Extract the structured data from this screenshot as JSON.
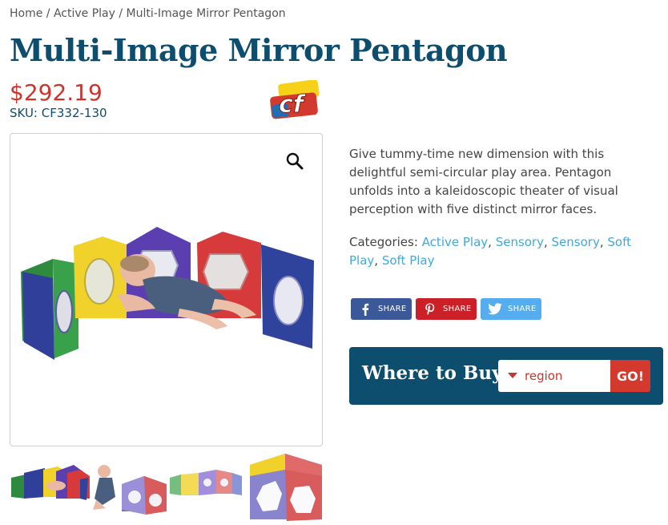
{
  "breadcrumb": {
    "home": "Home",
    "sep1": " / ",
    "category": "Active Play",
    "sep2": " / ",
    "current": "Multi-Image Mirror Pentagon"
  },
  "product": {
    "title": "Multi-Image Mirror Pentagon",
    "price": "$292.19",
    "sku_label": "SKU: ",
    "sku_value": "CF332-130",
    "brand_logo_text": "cf",
    "description": "Give tummy-time new dimension with this delightful semi-circular play area. Pentagon unfolds into a kaleidoscopic theater of visual perception with five distinct mirror faces.",
    "categories_label": "Categories: ",
    "categories": [
      "Active Play",
      "Sensory",
      "Sensory",
      "Soft Play",
      "Soft Play"
    ],
    "category_separator": ", "
  },
  "gallery": {
    "zoom_icon": "magnifier-icon",
    "thumbnail_count": 4
  },
  "share": {
    "facebook_label": "SHARE",
    "pinterest_label": "SHARE",
    "twitter_label": "SHARE"
  },
  "where_to_buy": {
    "label": "Where to Buy",
    "select_value": "region",
    "go_label": "GO!"
  },
  "colors": {
    "title": "#0d4d6e",
    "price": "#c8362e",
    "link": "#3fa9dd",
    "facebook": "#3b5998",
    "pinterest": "#cb2027",
    "twitter": "#55acee",
    "wtb_bg": "#0d4d6e",
    "go_btn": "#d4392d"
  }
}
